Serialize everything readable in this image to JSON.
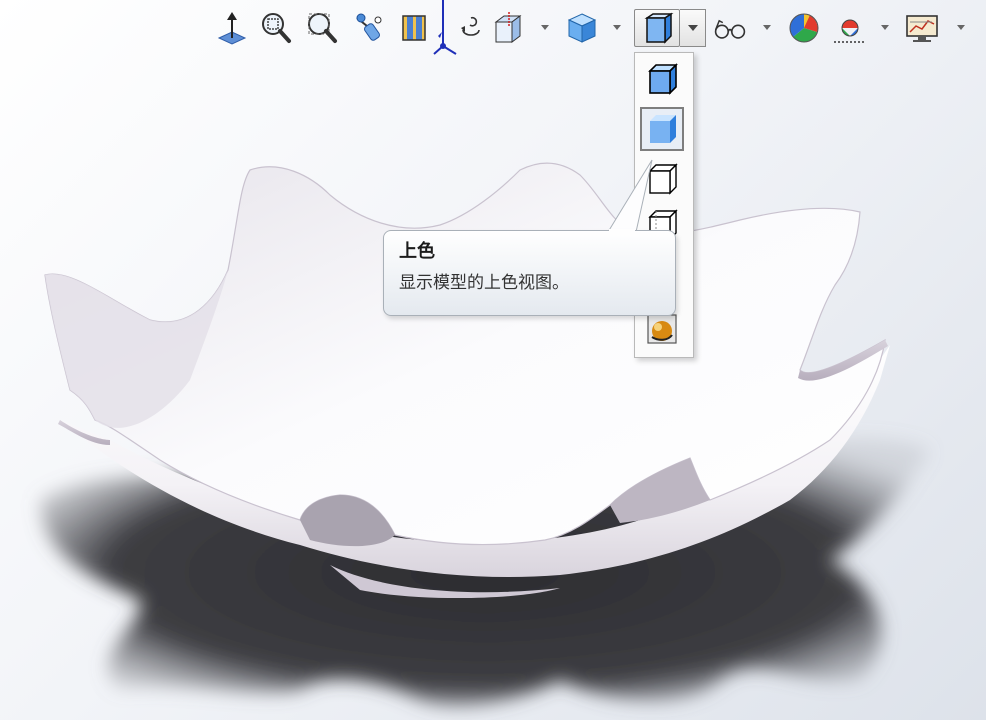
{
  "toolbar": {
    "items": [
      {
        "name": "view-orientation-normal-to-icon",
        "has_dropdown": false
      },
      {
        "name": "zoom-to-fit-icon",
        "has_dropdown": false
      },
      {
        "name": "zoom-to-area-icon",
        "has_dropdown": false
      },
      {
        "name": "previous-view-icon",
        "has_dropdown": false
      },
      {
        "name": "section-view-icon",
        "has_dropdown": false
      },
      {
        "name": "dynamic-annotation-views-icon",
        "has_dropdown": false
      },
      {
        "name": "view-orientation-icon",
        "has_dropdown": true
      },
      {
        "name": "display-style-icon",
        "has_dropdown": true
      },
      {
        "name": "shaded-display-icon",
        "has_dropdown": true,
        "active": true
      },
      {
        "name": "view-settings-glasses-icon",
        "has_dropdown": true
      },
      {
        "name": "edit-appearance-icon",
        "has_dropdown": false
      },
      {
        "name": "apply-scene-icon",
        "has_dropdown": true
      },
      {
        "name": "view-settings-monitor-icon",
        "has_dropdown": true
      }
    ]
  },
  "flyout": {
    "items": [
      {
        "name": "shaded-with-edges-icon",
        "selected": false
      },
      {
        "name": "shaded-icon",
        "selected": true
      },
      {
        "name": "hidden-lines-removed-icon",
        "selected": false
      },
      {
        "name": "hidden-lines-visible-icon",
        "selected": false
      },
      {
        "name": "realview-graphics-icon",
        "selected": false
      }
    ]
  },
  "tooltip": {
    "title": "上色",
    "description": "显示模型的上色视图。"
  },
  "model": {
    "description_color": "#f2f0f4",
    "shadow_color": "#3a3a3e"
  }
}
